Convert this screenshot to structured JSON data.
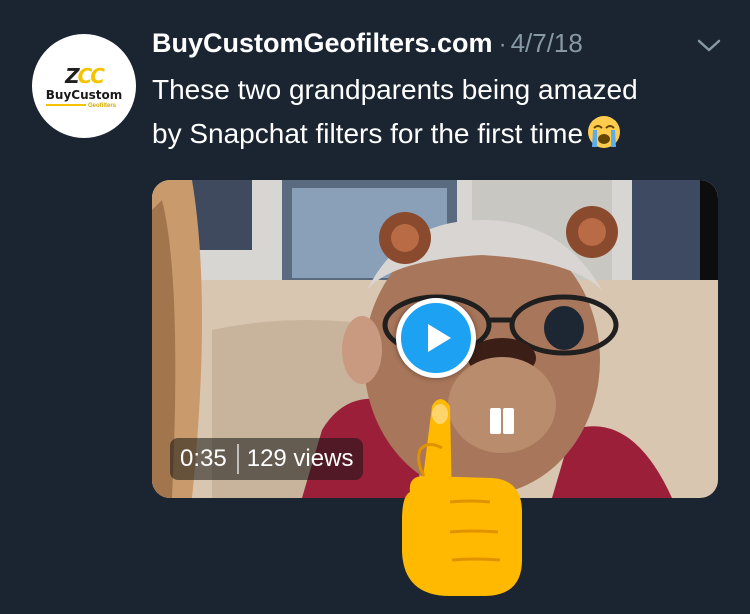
{
  "tweet": {
    "author": "BuyCustomGeofilters.com",
    "separator": "·",
    "date": "4/7/18",
    "text_line1": "These two grandparents being amazed",
    "text_line2": "by Snapchat filters for the first time",
    "emoji": "loudly-crying-face"
  },
  "avatar": {
    "logo_mark_a": "Z",
    "logo_mark_b": "CC",
    "brand": "BuyCustom",
    "sub": "Geofilters"
  },
  "video": {
    "duration": "0:35",
    "views": "129 views"
  },
  "overlay": {
    "emoji": "backhand-index-pointing-up"
  },
  "colors": {
    "background": "#1b2431",
    "accent": "#1da1f2",
    "muted": "#8899a6",
    "text": "#ffffff"
  }
}
